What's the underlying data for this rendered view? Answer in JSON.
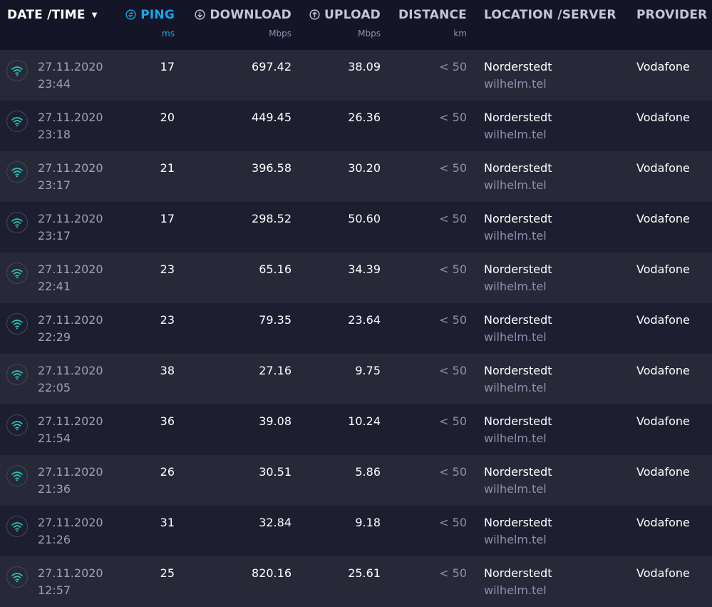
{
  "header": {
    "date_label": "DATE /TIME",
    "ping_label": "PING",
    "ping_unit": "ms",
    "download_label": "DOWNLOAD",
    "download_unit": "Mbps",
    "upload_label": "UPLOAD",
    "upload_unit": "Mbps",
    "distance_label": "DISTANCE",
    "distance_unit": "km",
    "location_label": "LOCATION /SERVER",
    "provider_label": "PROVIDER"
  },
  "icons": {
    "sort": "caret-down-icon",
    "ping": "ping-icon",
    "download": "download-arrow-icon",
    "upload": "upload-arrow-icon",
    "connection": "wifi-icon"
  },
  "colors": {
    "accent": "#1aa6e6",
    "wifi": "#29c5b8",
    "row_odd": "#272939",
    "row_even": "#1d1f30",
    "background": "#141526"
  },
  "rows": [
    {
      "date": "27.11.2020",
      "time": "23:44",
      "ping": "17",
      "download": "697.42",
      "upload": "38.09",
      "distance": "< 50",
      "location": "Norderstedt",
      "server": "wilhelm.tel",
      "provider": "Vodafone"
    },
    {
      "date": "27.11.2020",
      "time": "23:18",
      "ping": "20",
      "download": "449.45",
      "upload": "26.36",
      "distance": "< 50",
      "location": "Norderstedt",
      "server": "wilhelm.tel",
      "provider": "Vodafone"
    },
    {
      "date": "27.11.2020",
      "time": "23:17",
      "ping": "21",
      "download": "396.58",
      "upload": "30.20",
      "distance": "< 50",
      "location": "Norderstedt",
      "server": "wilhelm.tel",
      "provider": "Vodafone"
    },
    {
      "date": "27.11.2020",
      "time": "23:17",
      "ping": "17",
      "download": "298.52",
      "upload": "50.60",
      "distance": "< 50",
      "location": "Norderstedt",
      "server": "wilhelm.tel",
      "provider": "Vodafone"
    },
    {
      "date": "27.11.2020",
      "time": "22:41",
      "ping": "23",
      "download": "65.16",
      "upload": "34.39",
      "distance": "< 50",
      "location": "Norderstedt",
      "server": "wilhelm.tel",
      "provider": "Vodafone"
    },
    {
      "date": "27.11.2020",
      "time": "22:29",
      "ping": "23",
      "download": "79.35",
      "upload": "23.64",
      "distance": "< 50",
      "location": "Norderstedt",
      "server": "wilhelm.tel",
      "provider": "Vodafone"
    },
    {
      "date": "27.11.2020",
      "time": "22:05",
      "ping": "38",
      "download": "27.16",
      "upload": "9.75",
      "distance": "< 50",
      "location": "Norderstedt",
      "server": "wilhelm.tel",
      "provider": "Vodafone"
    },
    {
      "date": "27.11.2020",
      "time": "21:54",
      "ping": "36",
      "download": "39.08",
      "upload": "10.24",
      "distance": "< 50",
      "location": "Norderstedt",
      "server": "wilhelm.tel",
      "provider": "Vodafone"
    },
    {
      "date": "27.11.2020",
      "time": "21:36",
      "ping": "26",
      "download": "30.51",
      "upload": "5.86",
      "distance": "< 50",
      "location": "Norderstedt",
      "server": "wilhelm.tel",
      "provider": "Vodafone"
    },
    {
      "date": "27.11.2020",
      "time": "21:26",
      "ping": "31",
      "download": "32.84",
      "upload": "9.18",
      "distance": "< 50",
      "location": "Norderstedt",
      "server": "wilhelm.tel",
      "provider": "Vodafone"
    },
    {
      "date": "27.11.2020",
      "time": "12:57",
      "ping": "25",
      "download": "820.16",
      "upload": "25.61",
      "distance": "< 50",
      "location": "Norderstedt",
      "server": "wilhelm.tel",
      "provider": "Vodafone"
    }
  ]
}
